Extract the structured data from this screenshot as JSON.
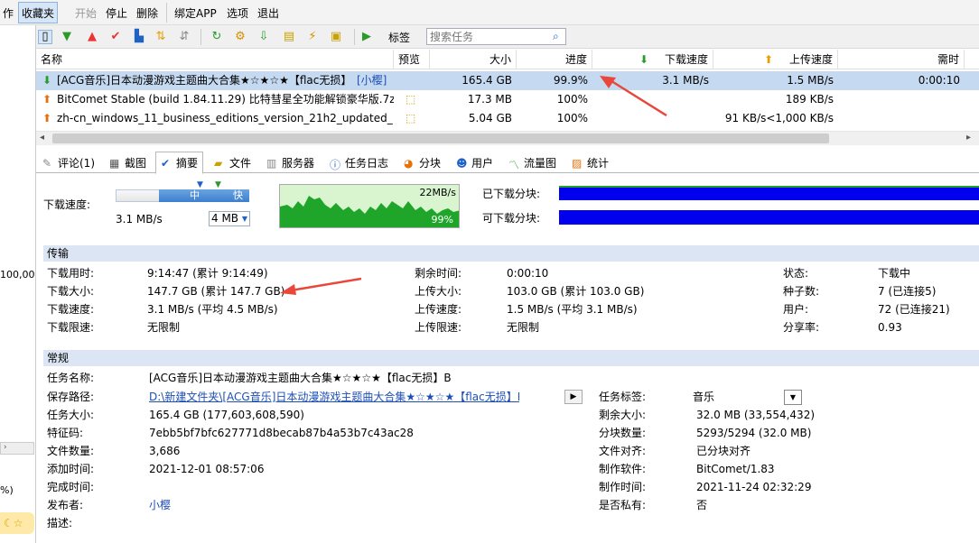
{
  "toolbar": {
    "cut_label": "作",
    "favorites_label": "收藏夹",
    "start_label": "开始",
    "stop_label": "停止",
    "delete_label": "删除",
    "bind_app_label": "绑定APP",
    "options_label": "选项",
    "exit_label": "退出"
  },
  "sub_toolbar": {
    "tags_label": "标签",
    "search_placeholder": "搜索任务"
  },
  "list": {
    "headers": {
      "name": "名称",
      "preview": "预览",
      "size": "大小",
      "progress": "进度",
      "down_speed": "下载速度",
      "up_speed": "上传速度",
      "eta": "需时"
    },
    "rows": [
      {
        "name": "[ACG音乐]日本动漫游戏主题曲大合集★☆★☆★【flac无损】B",
        "tag": "[小樱]",
        "size": "165.4 GB",
        "progress": "99.9%",
        "down": "3.1 MB/s",
        "up": "1.5 MB/s",
        "eta": "0:00:10"
      },
      {
        "name": "BitComet Stable (build 1.84.11.29) 比特彗星全功能解锁豪华版.7z",
        "size": "17.3 MB",
        "progress": "100%",
        "down": "",
        "up": "189 KB/s",
        "eta": ""
      },
      {
        "name": "zh-cn_windows_11_business_editions_version_21h2_updated_...",
        "size": "5.04 GB",
        "progress": "100%",
        "down": "",
        "up": "91 KB/s<1,000 KB/s",
        "eta": ""
      }
    ]
  },
  "tabs": [
    "评论(1)",
    "截图",
    "摘要",
    "文件",
    "服务器",
    "任务日志",
    "分块",
    "用户",
    "流量图",
    "统计"
  ],
  "speed_panel": {
    "label": "下载速度:",
    "slider_mid": "中",
    "slider_fast": "快",
    "current": "3.1 MB/s",
    "limit_value": "4 MB",
    "graph_top": "22MB/s",
    "graph_pct": "99%",
    "downloaded_blocks": "已下载分块:",
    "available_blocks": "可下载分块:"
  },
  "transfer": {
    "title": "传输",
    "rows": [
      {
        "l1": "下载用时:",
        "v1": "9:14:47 (累计 9:14:49)",
        "l2": "剩余时间:",
        "v2": "0:00:10",
        "l3": "状态:",
        "v3": "下载中"
      },
      {
        "l1": "下载大小:",
        "v1": "147.7 GB (累计 147.7 GB)",
        "l2": "上传大小:",
        "v2": "103.0 GB (累计 103.0 GB)",
        "l3": "种子数:",
        "v3": "7 (已连接5)"
      },
      {
        "l1": "下载速度:",
        "v1": "3.1 MB/s (平均 4.5 MB/s)",
        "l2": "上传速度:",
        "v2": "1.5 MB/s (平均 3.1 MB/s)",
        "l3": "用户:",
        "v3": "72 (已连接21)"
      },
      {
        "l1": "下载限速:",
        "v1": "无限制",
        "l2": "上传限速:",
        "v2": "无限制",
        "l3": "分享率:",
        "v3": "0.93"
      }
    ]
  },
  "general": {
    "title": "常规",
    "task_name_label": "任务名称:",
    "task_name": "[ACG音乐]日本动漫游戏主题曲大合集★☆★☆★【flac无损】B",
    "save_path_label": "保存路径:",
    "save_path": "D:\\新建文件夹\\[ACG音乐]日本动漫游戏主题曲大合集★☆★☆★【flac无损】B",
    "task_size_label": "任务大小:",
    "task_size": "165.4 GB (177,603,608,590)",
    "hash_label": "特征码:",
    "hash": "7ebb5bf7bfc627771d8becab87b4a53b7c43ac28",
    "file_count_label": "文件数量:",
    "file_count": "3,686",
    "added_label": "添加时间:",
    "added": "2021-12-01 08:57:06",
    "completed_label": "完成时间:",
    "publisher_label": "发布者:",
    "publisher": "小樱",
    "desc_label": "描述:",
    "tag_label": "任务标签:",
    "tag_value": "音乐",
    "remaining_label": "剩余大小:",
    "remaining": "32.0 MB (33,554,432)",
    "pieces_label": "分块数量:",
    "pieces": "5293/5294 (32.0 MB)",
    "align_label": "文件对齐:",
    "align": "已分块对齐",
    "software_label": "制作软件:",
    "software": "BitComet/1.83",
    "made_label": "制作时间:",
    "made": "2021-11-24 02:32:29",
    "private_label": "是否私有:",
    "private": "否"
  },
  "left_strip": {
    "fragment1": "100,00",
    "fragment2": "%)"
  },
  "colors": {
    "selection": "#c5d9f1",
    "section_header": "#dbe5f3",
    "block_bar": "#0000ee",
    "graph_green": "#1fa52a",
    "annotation_arrow": "#e8473a"
  }
}
